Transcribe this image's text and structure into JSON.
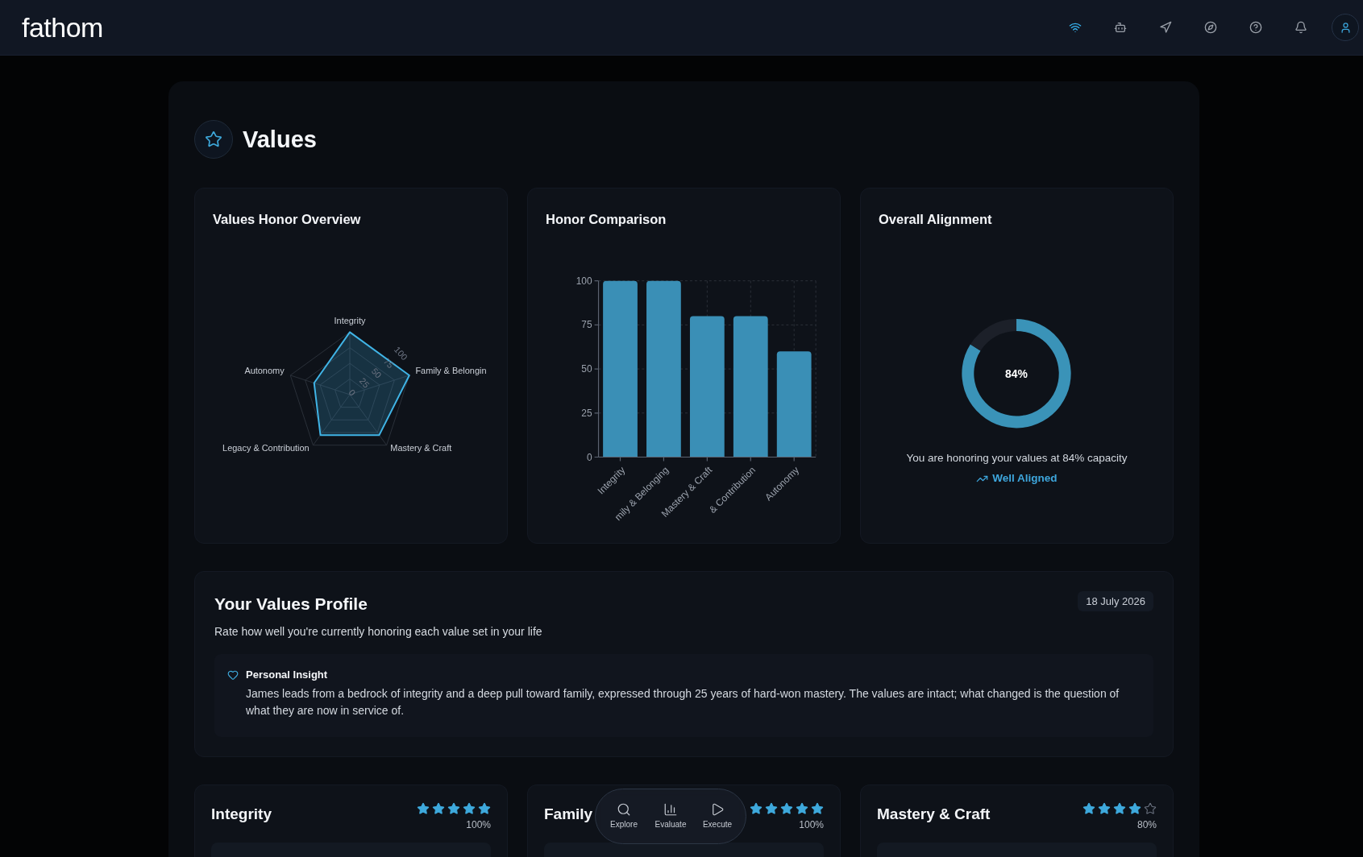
{
  "header": {
    "logo": "fathom",
    "tools": [
      {
        "kind": "wifi",
        "selected": true
      },
      {
        "kind": "bot",
        "selected": false
      },
      {
        "kind": "navigation",
        "selected": false
      },
      {
        "kind": "compass",
        "selected": false
      },
      {
        "kind": "help",
        "selected": false
      },
      {
        "kind": "bell",
        "selected": false
      }
    ]
  },
  "page": {
    "title": "Values"
  },
  "overview_cards": [
    {
      "title": "Values Honor Overview",
      "chart_data": {
        "type": "radar",
        "categories": [
          "Integrity",
          "Family & Belongin",
          "Mastery & Craft",
          "Legacy & Contribution",
          "Autonomy"
        ],
        "values": [
          100,
          100,
          80,
          80,
          60
        ],
        "ylim": [
          0,
          100
        ],
        "yticks": [
          0,
          25,
          50,
          75,
          100
        ],
        "grid": true
      }
    },
    {
      "title": "Honor Comparison",
      "chart_data": {
        "type": "bar",
        "categories": [
          "Integrity",
          "mily & Belonging",
          "Mastery & Craft",
          "& Contribution",
          "Autonomy"
        ],
        "values": [
          100,
          100,
          80,
          80,
          60
        ],
        "ylim": [
          0,
          100
        ],
        "yticks": [
          0,
          25,
          50,
          75,
          100
        ],
        "grid": true
      }
    },
    {
      "title": "Overall Alignment",
      "chart_data": {
        "type": "donut",
        "values": [
          84,
          16
        ]
      },
      "value": "84%",
      "caption": "You are honoring your values at 84% capacity",
      "status": "Well Aligned"
    }
  ],
  "profile": {
    "title": "Your Values Profile",
    "subtitle": "Rate how well you're currently honoring each value set in your life",
    "date": "18 July 2026",
    "insight": {
      "title": "Personal Insight",
      "text": "James leads from a bedrock of integrity and a deep pull toward family, expressed through 25 years of hard-won mastery. The values are intact; what changed is the question of what they are now in service of."
    }
  },
  "value_cards": [
    {
      "title": "Integrity",
      "stars": 5,
      "percent": "100%"
    },
    {
      "title": "Family",
      "stars": 5,
      "percent": "100%"
    },
    {
      "title": "Mastery & Craft",
      "stars": 4,
      "percent": "80%"
    }
  ],
  "dock": [
    {
      "kind": "search",
      "label": "Explore"
    },
    {
      "kind": "chart",
      "label": "Evaluate"
    },
    {
      "kind": "play",
      "label": "Execute"
    }
  ]
}
